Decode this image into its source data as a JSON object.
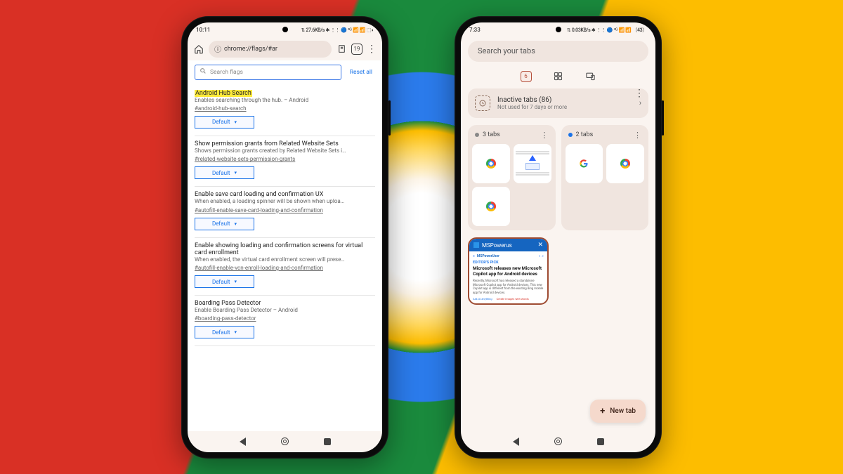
{
  "phone1": {
    "statusbar": {
      "time": "10:11",
      "icons": "⇅ 27.6KB/s ✱ ⋮⋮ 🔵 ⁴ᴳ 📶 📶 ⬚◗"
    },
    "toolbar": {
      "url": "chrome://flags/#ar",
      "tab_count": "19"
    },
    "search": {
      "placeholder": "Search flags",
      "reset": "Reset all"
    },
    "flags": [
      {
        "title": "Android Hub Search",
        "highlight": true,
        "desc": "Enables searching through the hub. – Android",
        "link": "#android-hub-search",
        "value": "Default"
      },
      {
        "title": "Show permission grants from Related Website Sets",
        "desc": "Shows permission grants created by Related Website Sets i…",
        "link": "#related-website-sets-permission-grants",
        "value": "Default"
      },
      {
        "title": "Enable save card loading and confirmation UX",
        "desc": "When enabled, a loading spinner will be shown when uploa…",
        "link": "#autofill-enable-save-card-loading-and-confirmation",
        "value": "Default"
      },
      {
        "title": "Enable showing loading and confirmation screens for virtual card enrollment",
        "desc": "When enabled, the virtual card enrollment screen will prese…",
        "link": "#autofill-enable-vcn-enroll-loading-and-confirmation",
        "value": "Default"
      },
      {
        "title": "Boarding Pass Detector",
        "desc": "Enable Boarding Pass Detector – Android",
        "link": "#boarding-pass-detector",
        "value": "Default"
      }
    ]
  },
  "phone2": {
    "statusbar": {
      "time": "7:33",
      "icons": "⇅ 0.03KB/s ✱ ⋮⋮ 🔵 ⁴ᴳ 📶 📶 〔43〕"
    },
    "search": {
      "placeholder": "Search your tabs"
    },
    "active_tab_count": "6",
    "inactive": {
      "title": "Inactive tabs (86)",
      "subtitle": "Not used for 7 days or more"
    },
    "groups": [
      {
        "dot": "gray",
        "label": "3 tabs"
      },
      {
        "dot": "blue",
        "label": "2 tabs"
      }
    ],
    "active_tab": {
      "tab_title": "MSPowerus",
      "site": "MSPowerUser",
      "pick": "EDITOR'S PICK",
      "headline": "Microsoft releases new Microsoft Copilot app for Android devices",
      "body": "Recently, Microsoft has released a standalone Microsoft Copilot app for Android devices. This new Copilot app is different from the existing Bing mobile app for Android devices.",
      "link1": "Ask AI anything",
      "link2": "Create images with words"
    },
    "new_tab": "New tab"
  }
}
